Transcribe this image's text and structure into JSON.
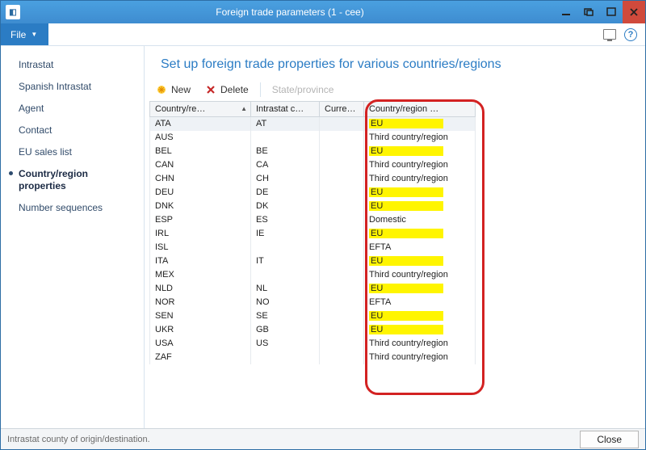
{
  "window": {
    "title": "Foreign trade parameters (1 - cee)"
  },
  "menubar": {
    "file": "File"
  },
  "sidebar": {
    "items": [
      {
        "label": "Intrastat"
      },
      {
        "label": "Spanish Intrastat"
      },
      {
        "label": "Agent"
      },
      {
        "label": "Contact"
      },
      {
        "label": "EU sales list"
      },
      {
        "label": "Country/region properties"
      },
      {
        "label": "Number sequences"
      }
    ],
    "active_index": 5
  },
  "page": {
    "title": "Set up foreign trade properties for various countries/regions"
  },
  "toolbar": {
    "new_label": "New",
    "delete_label": "Delete",
    "state_label": "State/province"
  },
  "grid": {
    "columns": [
      {
        "header": "Country/re…",
        "sort": "asc"
      },
      {
        "header": "Intrastat c…"
      },
      {
        "header": "Curre…"
      },
      {
        "header": "Country/region …"
      }
    ],
    "rows": [
      {
        "c0": "ATA",
        "c1": "AT",
        "c2": "",
        "c3": "EU",
        "hl": true
      },
      {
        "c0": "AUS",
        "c1": "",
        "c2": "",
        "c3": "Third country/region",
        "hl": false
      },
      {
        "c0": "BEL",
        "c1": "BE",
        "c2": "",
        "c3": "EU",
        "hl": true
      },
      {
        "c0": "CAN",
        "c1": "CA",
        "c2": "",
        "c3": "Third country/region",
        "hl": false
      },
      {
        "c0": "CHN",
        "c1": "CH",
        "c2": "",
        "c3": "Third country/region",
        "hl": false
      },
      {
        "c0": "DEU",
        "c1": "DE",
        "c2": "",
        "c3": "EU",
        "hl": true
      },
      {
        "c0": "DNK",
        "c1": "DK",
        "c2": "",
        "c3": "EU",
        "hl": true
      },
      {
        "c0": "ESP",
        "c1": "ES",
        "c2": "",
        "c3": "Domestic",
        "hl": false
      },
      {
        "c0": "IRL",
        "c1": "IE",
        "c2": "",
        "c3": "EU",
        "hl": true
      },
      {
        "c0": "ISL",
        "c1": "",
        "c2": "",
        "c3": "EFTA",
        "hl": false
      },
      {
        "c0": "ITA",
        "c1": "IT",
        "c2": "",
        "c3": "EU",
        "hl": true
      },
      {
        "c0": "MEX",
        "c1": "",
        "c2": "",
        "c3": "Third country/region",
        "hl": false
      },
      {
        "c0": "NLD",
        "c1": "NL",
        "c2": "",
        "c3": "EU",
        "hl": true
      },
      {
        "c0": "NOR",
        "c1": "NO",
        "c2": "",
        "c3": "EFTA",
        "hl": false
      },
      {
        "c0": "SEN",
        "c1": "SE",
        "c2": "",
        "c3": "EU",
        "hl": true
      },
      {
        "c0": "UKR",
        "c1": "GB",
        "c2": "",
        "c3": "EU",
        "hl": true
      },
      {
        "c0": "USA",
        "c1": "US",
        "c2": "",
        "c3": "Third country/region",
        "hl": false
      },
      {
        "c0": "ZAF",
        "c1": "",
        "c2": "",
        "c3": "Third country/region",
        "hl": false
      }
    ]
  },
  "statusbar": {
    "text": "Intrastat county of origin/destination."
  },
  "buttons": {
    "close": "Close"
  }
}
